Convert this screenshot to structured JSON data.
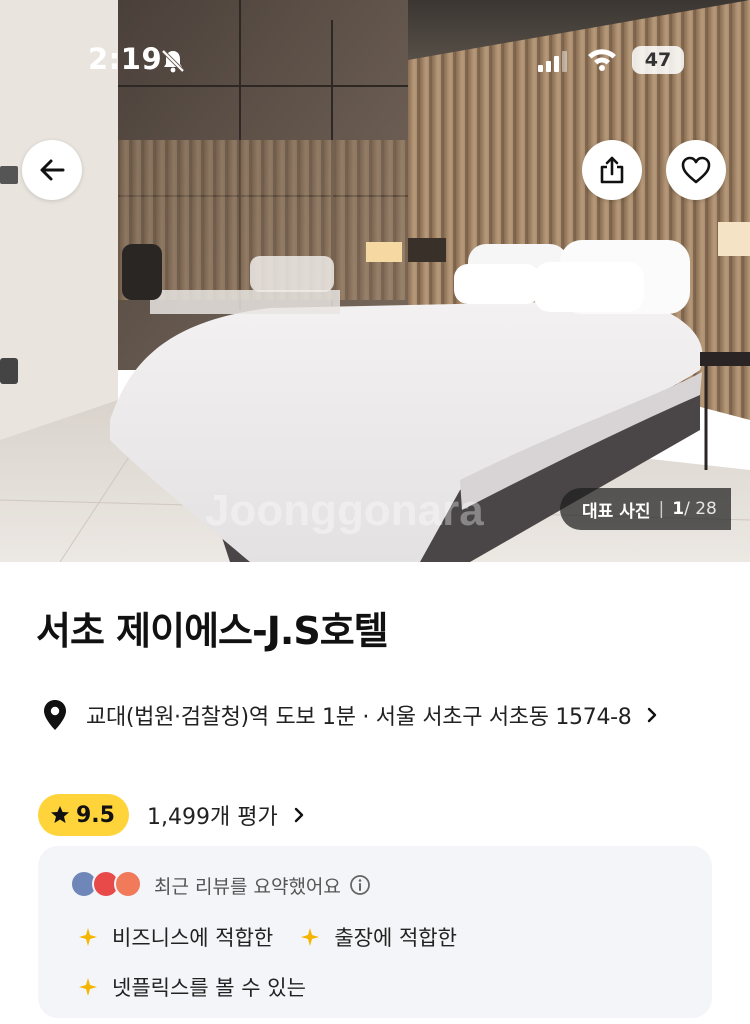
{
  "status_bar": {
    "time": "2:19",
    "battery": "47",
    "icons": [
      "bell-slash-icon",
      "cellular-signal-icon",
      "wifi-icon",
      "battery-icon"
    ]
  },
  "hero": {
    "photo_label": "대표 사진",
    "photo_separator": "|",
    "photo_current": "1",
    "photo_total": "/ 28"
  },
  "actions": {
    "back_icon": "arrow-left-icon",
    "share_icon": "share-icon",
    "like_icon": "heart-icon"
  },
  "hotel": {
    "name": "서초 제이에스-J.S호텔",
    "address": "교대(법원·검찰청)역 도보 1분 · 서울 서초구 서초동 1574-8"
  },
  "rating": {
    "score": "9.5",
    "review_count": "1,499개 평가"
  },
  "review_summary": {
    "heading": "최근 리뷰를 요약했어요",
    "tags": [
      "비즈니스에 적합한",
      "출장에 적합한",
      "넷플릭스를 볼 수 있는"
    ]
  },
  "colors": {
    "rating_badge": "#ffd43b",
    "spark": "#f5b400",
    "summary_bg": "#f4f5f9"
  }
}
